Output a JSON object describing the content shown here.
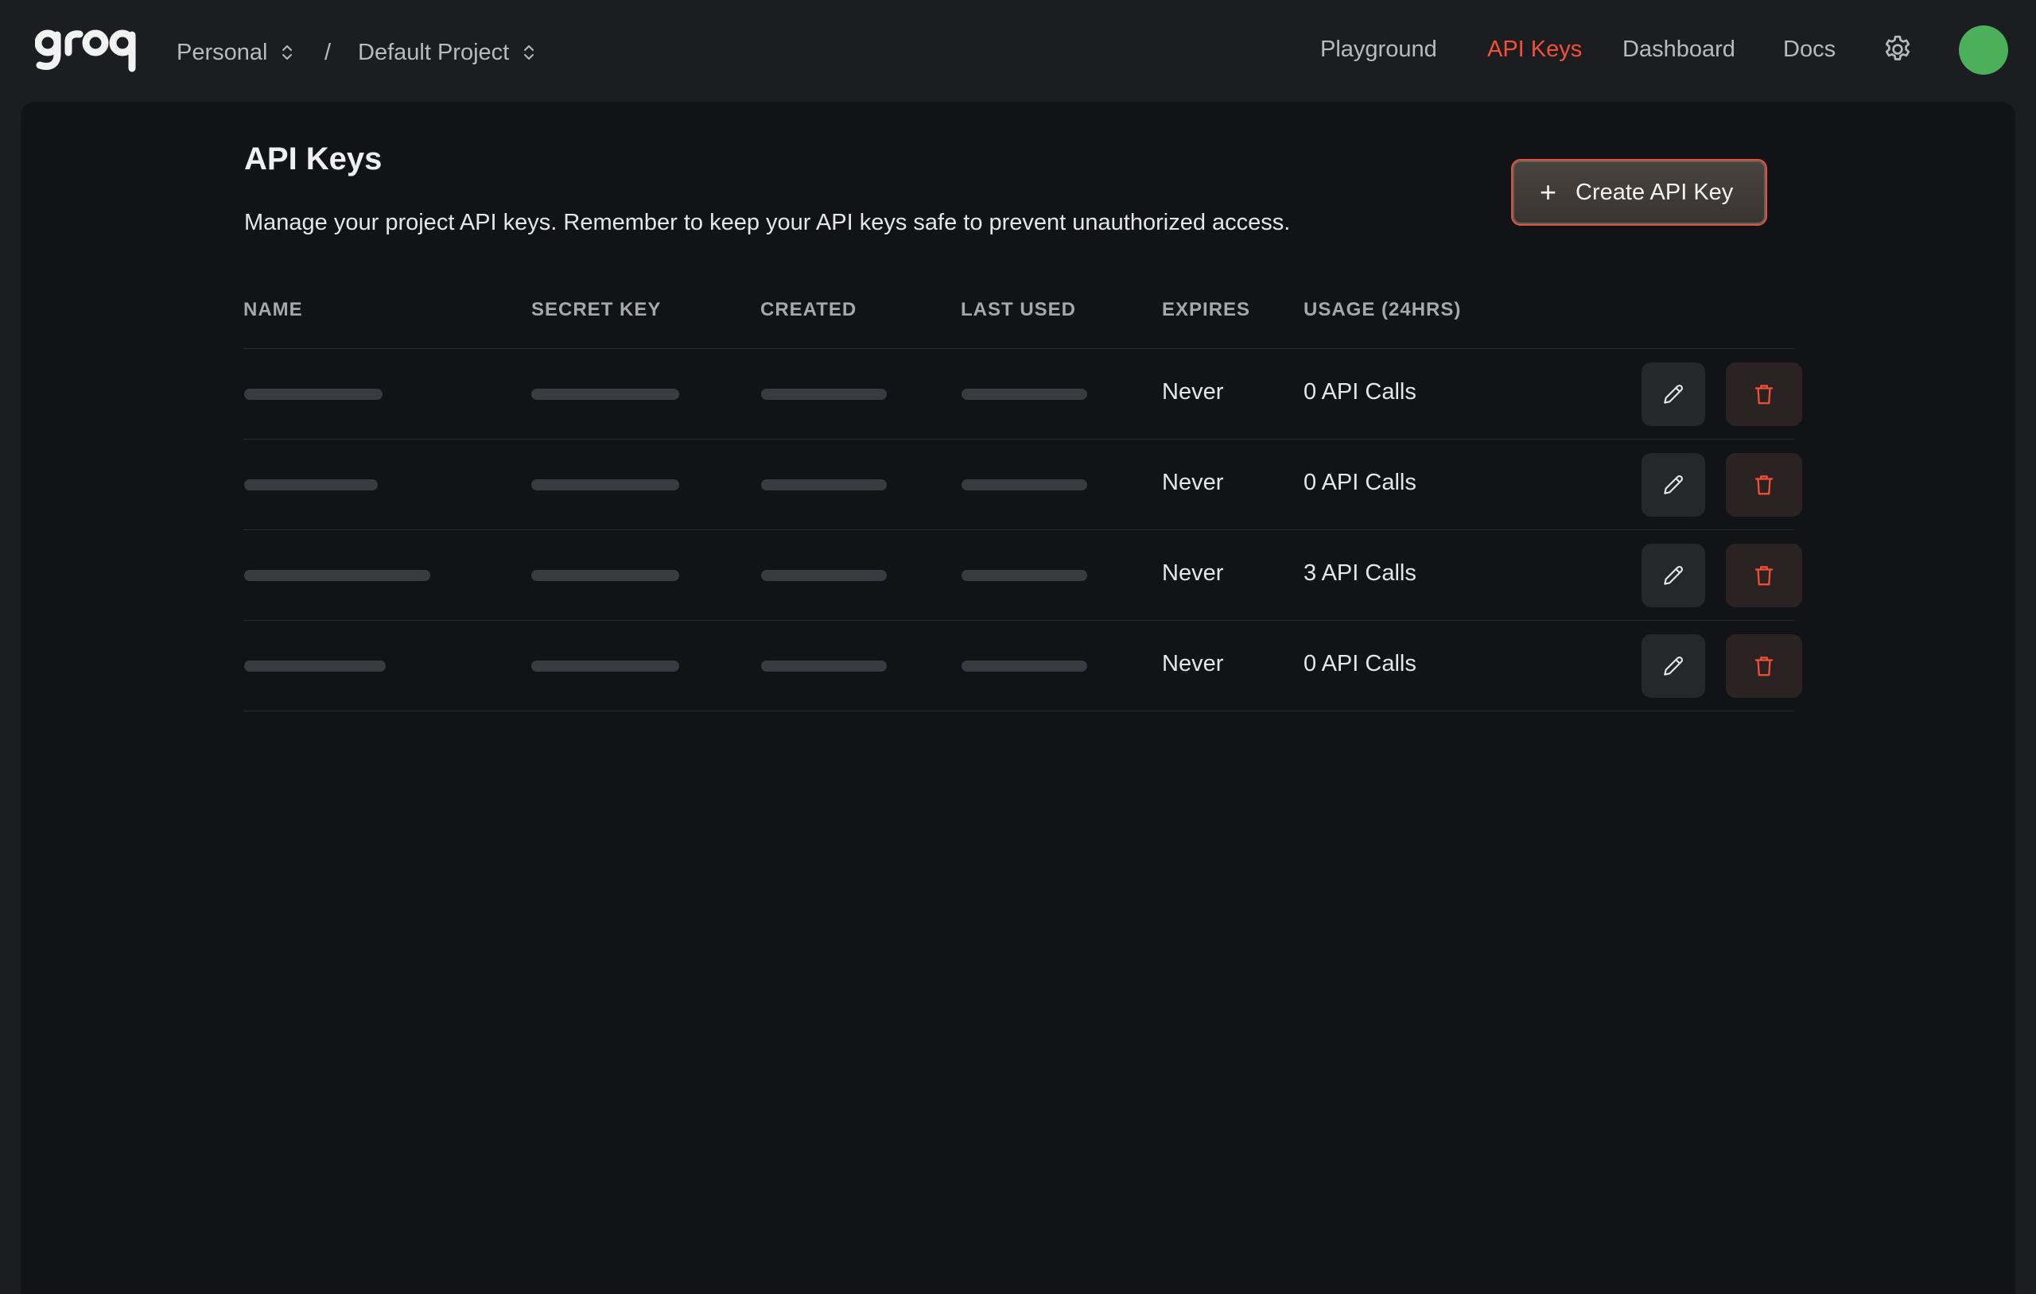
{
  "brand": {
    "logo_text": "groq"
  },
  "breadcrumb": {
    "org": "Personal",
    "separator": "/",
    "project": "Default Project"
  },
  "nav": {
    "items": [
      {
        "label": "Playground",
        "active": false
      },
      {
        "label": "API Keys",
        "active": true
      },
      {
        "label": "Dashboard",
        "active": false
      },
      {
        "label": "Docs",
        "active": false
      }
    ]
  },
  "colors": {
    "accent": "#f55036",
    "avatar": "#4caf5a",
    "background": "#1c1d21",
    "panel": "#121316"
  },
  "icons": {
    "settings": "gear-icon",
    "edit": "pencil-icon",
    "delete": "trash-icon",
    "add": "plus-icon",
    "selector": "chevron-updown-icon"
  },
  "page": {
    "title": "API Keys",
    "description": "Manage your project API keys. Remember to keep your API keys safe to prevent unauthorized access.",
    "create_button": "Create API Key"
  },
  "table": {
    "columns": [
      "NAME",
      "SECRET KEY",
      "CREATED",
      "LAST USED",
      "EXPIRES",
      "USAGE (24HRS)"
    ],
    "rows": [
      {
        "expires": "Never",
        "usage": "0 API Calls"
      },
      {
        "expires": "Never",
        "usage": "0 API Calls"
      },
      {
        "expires": "Never",
        "usage": "3 API Calls"
      },
      {
        "expires": "Never",
        "usage": "0 API Calls"
      }
    ]
  }
}
